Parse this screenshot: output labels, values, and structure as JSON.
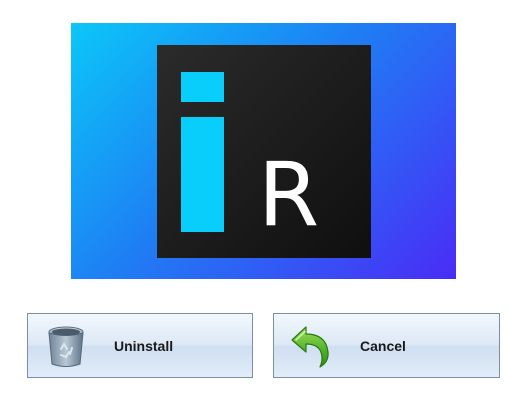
{
  "banner": {
    "logo_letter": "R",
    "gradient_colors": [
      "#0bc7f8",
      "#1e7ff4",
      "#4a2cf6"
    ],
    "logo_accent": "#09cdfb",
    "logo_background": "#1f1f1f"
  },
  "actions": {
    "uninstall": {
      "label": "Uninstall",
      "icon": "recycle-bin-icon"
    },
    "cancel": {
      "label": "Cancel",
      "icon": "back-arrow-icon"
    }
  }
}
